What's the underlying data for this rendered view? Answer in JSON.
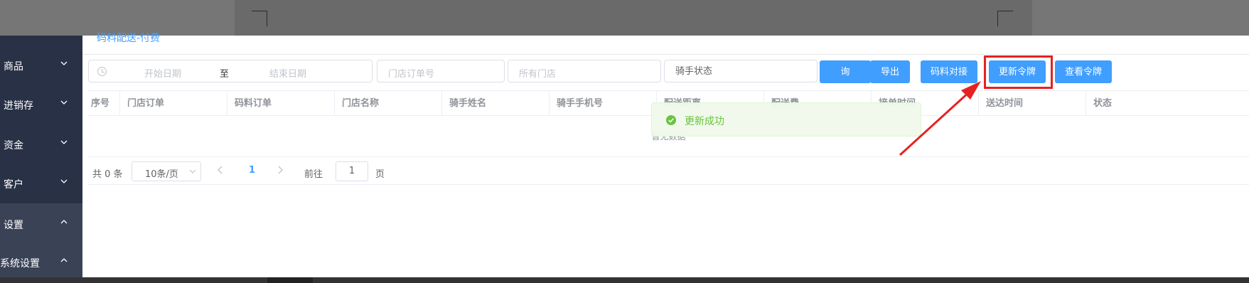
{
  "page_title": "码料配送-付费",
  "sidebar": {
    "items": [
      {
        "label": "商品"
      },
      {
        "label": "进销存"
      },
      {
        "label": "资金"
      },
      {
        "label": "客户"
      },
      {
        "label": "设置"
      },
      {
        "label": "系统设置"
      }
    ]
  },
  "filters": {
    "start_date_placeholder": "开始日期",
    "range_separator": "至",
    "end_date_placeholder": "结束日期",
    "store_order_placeholder": "门店订单号",
    "store_placeholder": "所有门店",
    "rider_partial": "骑手状态"
  },
  "toolbar": {
    "query_label": "询",
    "export_label": "导出",
    "reconcile_label": "码料对接",
    "update_token_label": "更新令牌",
    "view_token_label": "查看令牌"
  },
  "table": {
    "columns": [
      "序号",
      "门店订单",
      "码料订单",
      "门店名称",
      "骑手姓名",
      "骑手手机号",
      "配送距离",
      "配送费",
      "接单时间",
      "送达时间",
      "状态"
    ],
    "empty_text": "暂无数据"
  },
  "pagination": {
    "total_text": "共 0 条",
    "page_size": "10条/页",
    "current_page": "1",
    "goto_label": "前往",
    "goto_value": "1",
    "page_unit": "页"
  },
  "toast": {
    "message": "更新成功"
  },
  "colors": {
    "accent": "#409eff",
    "sidebar_bg": "#293146",
    "success": "#67c23a",
    "highlight": "#e52222"
  }
}
